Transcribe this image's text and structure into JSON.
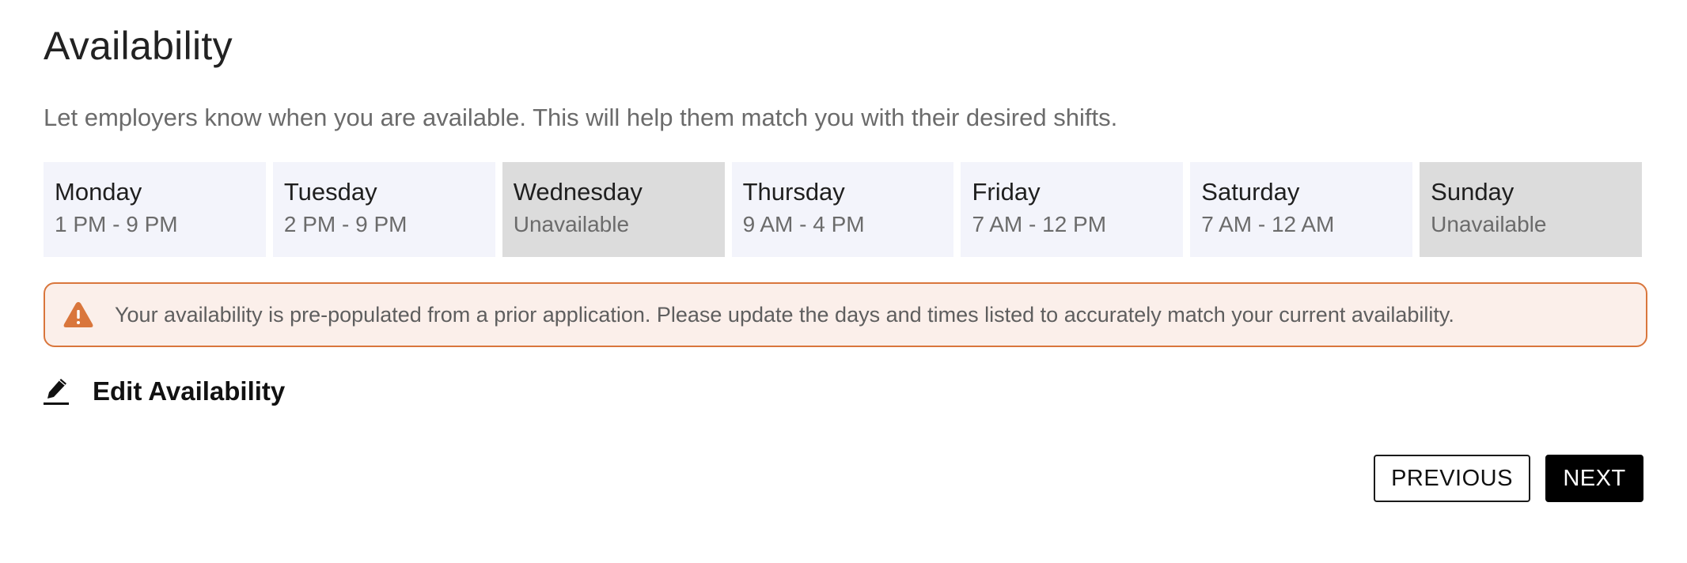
{
  "header": {
    "title": "Availability",
    "subtitle": "Let employers know when you are available. This will help them match you with their desired shifts."
  },
  "days": [
    {
      "name": "Monday",
      "hours": "1 PM - 9 PM",
      "available": true
    },
    {
      "name": "Tuesday",
      "hours": "2 PM - 9 PM",
      "available": true
    },
    {
      "name": "Wednesday",
      "hours": "Unavailable",
      "available": false
    },
    {
      "name": "Thursday",
      "hours": "9 AM - 4 PM",
      "available": true
    },
    {
      "name": "Friday",
      "hours": "7 AM - 12 PM",
      "available": true
    },
    {
      "name": "Saturday",
      "hours": "7 AM - 12 AM",
      "available": true
    },
    {
      "name": "Sunday",
      "hours": "Unavailable",
      "available": false
    }
  ],
  "alert": {
    "icon": "warning-icon",
    "text": "Your availability is pre-populated from a prior application. Please update the days and times listed to accurately match your current availability.",
    "border_color": "#d9763c",
    "background_color": "#fbefea"
  },
  "edit": {
    "icon": "pencil-icon",
    "label": "Edit Availability"
  },
  "buttons": {
    "previous_label": "PREVIOUS",
    "next_label": "NEXT"
  },
  "colors": {
    "available_card": "#f3f4fb",
    "unavailable_card": "#dcdcdc",
    "primary_button": "#000000",
    "warning_icon": "#d9763c"
  }
}
